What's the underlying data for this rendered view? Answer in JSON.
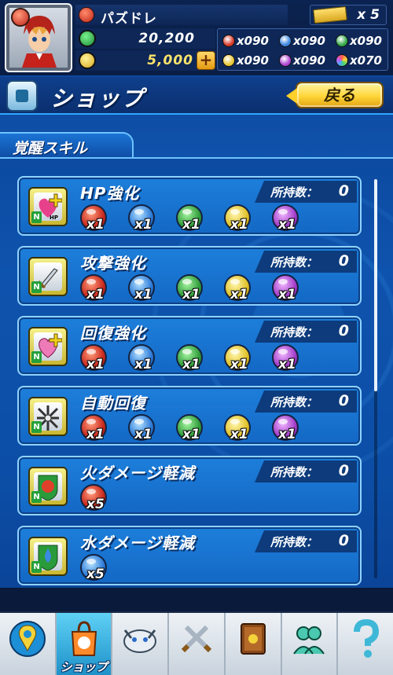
{
  "player": {
    "name": "パズドレ",
    "rank_points": "20,200",
    "coins": "5,000"
  },
  "tickets": {
    "count": "x 5"
  },
  "orbs": [
    {
      "type": "fire",
      "count": "x090",
      "color": "#d63a2a"
    },
    {
      "type": "water",
      "count": "x090",
      "color": "#3a86e0"
    },
    {
      "type": "wood",
      "count": "x090",
      "color": "#34a848"
    },
    {
      "type": "light",
      "count": "x090",
      "color": "#e6c634"
    },
    {
      "type": "dark",
      "count": "x090",
      "color": "#ae45d1"
    },
    {
      "type": "rainbow",
      "count": "x070",
      "color": "#c97bd8"
    }
  ],
  "shop": {
    "title": "ショップ",
    "back_label": "戻る"
  },
  "section": {
    "title": "覚醒スキル"
  },
  "owned_label": "所持数：",
  "skills": [
    {
      "name": "HP強化",
      "owned": "0",
      "icon": "hp-heart-icon",
      "cost": [
        {
          "orb": "fire",
          "qty": "x1"
        },
        {
          "orb": "water",
          "qty": "x1"
        },
        {
          "orb": "wood",
          "qty": "x1"
        },
        {
          "orb": "light",
          "qty": "x1"
        },
        {
          "orb": "dark",
          "qty": "x1"
        }
      ]
    },
    {
      "name": "攻撃強化",
      "owned": "0",
      "icon": "sword-icon",
      "cost": [
        {
          "orb": "fire",
          "qty": "x1"
        },
        {
          "orb": "water",
          "qty": "x1"
        },
        {
          "orb": "wood",
          "qty": "x1"
        },
        {
          "orb": "light",
          "qty": "x1"
        },
        {
          "orb": "dark",
          "qty": "x1"
        }
      ]
    },
    {
      "name": "回復強化",
      "owned": "0",
      "icon": "heal-heart-icon",
      "cost": [
        {
          "orb": "fire",
          "qty": "x1"
        },
        {
          "orb": "water",
          "qty": "x1"
        },
        {
          "orb": "wood",
          "qty": "x1"
        },
        {
          "orb": "light",
          "qty": "x1"
        },
        {
          "orb": "dark",
          "qty": "x1"
        }
      ]
    },
    {
      "name": "自動回復",
      "owned": "0",
      "icon": "auto-heal-icon",
      "cost": [
        {
          "orb": "fire",
          "qty": "x1"
        },
        {
          "orb": "water",
          "qty": "x1"
        },
        {
          "orb": "wood",
          "qty": "x1"
        },
        {
          "orb": "light",
          "qty": "x1"
        },
        {
          "orb": "dark",
          "qty": "x1"
        }
      ]
    },
    {
      "name": "火ダメージ軽減",
      "owned": "0",
      "icon": "fire-shield-icon",
      "cost": [
        {
          "orb": "fire",
          "qty": "x5"
        }
      ]
    },
    {
      "name": "水ダメージ軽減",
      "owned": "0",
      "icon": "water-shield-icon",
      "cost": [
        {
          "orb": "water",
          "qty": "x5"
        }
      ]
    }
  ],
  "nav": [
    {
      "id": "home",
      "icon": "map-pin-icon",
      "label": ""
    },
    {
      "id": "shop",
      "icon": "shop-bag-icon",
      "label": "ショップ",
      "active": true
    },
    {
      "id": "monster",
      "icon": "dragon-icon",
      "label": ""
    },
    {
      "id": "dungeon",
      "icon": "swords-icon",
      "label": ""
    },
    {
      "id": "book",
      "icon": "book-icon",
      "label": ""
    },
    {
      "id": "friends",
      "icon": "friends-icon",
      "label": ""
    },
    {
      "id": "help",
      "icon": "question-icon",
      "label": ""
    }
  ]
}
